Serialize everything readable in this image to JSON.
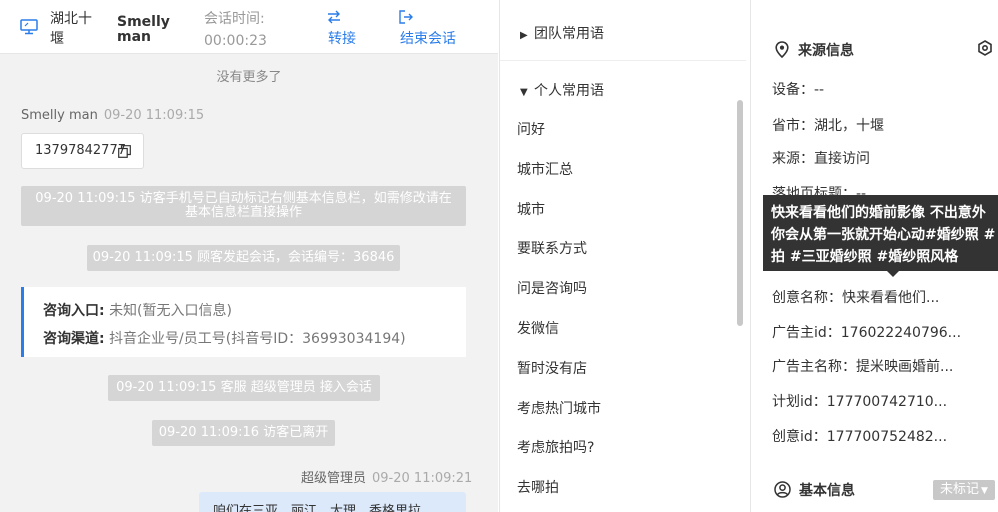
{
  "header": {
    "location": "湖北十堰",
    "visitor_name": "Smelly man",
    "session_time_label": "会话时间:",
    "session_time_value": "00:00:23",
    "transfer_label": "转接",
    "end_label": "结束会话",
    "accent_color": "#2b7de9"
  },
  "chat": {
    "no_more": "没有更多了",
    "visitor_msg": {
      "sender": "Smelly man",
      "time": "09-20 11:09:15",
      "text": "13797842777"
    },
    "system_msgs": [
      {
        "line1": "09-20 11:09:15 访客手机号已自动标记右侧基本信息栏，如需修改请在",
        "line2": "基本信息栏直接操作"
      },
      {
        "text": "09-20 11:09:15 顾客发起会话，会话编号：36846"
      },
      {
        "text": "09-20 11:09:15 客服 超级管理员 接入会话"
      },
      {
        "text": "09-20 11:09:16 访客已离开"
      }
    ],
    "info_card": {
      "entry_label": "咨询入口:",
      "entry_value": "未知(暂无入口信息)",
      "channel_label": "咨询渠道:",
      "channel_value": "抖音企业号/员工号(抖音号ID：36993034194)"
    },
    "agent_msg": {
      "sender": "超级管理员",
      "time": "09-20 11:09:21",
      "text": "咱们在三亚，丽江，大理，香格里拉"
    }
  },
  "phrases": {
    "team_label": "团队常用语",
    "personal_label": "个人常用语",
    "items": [
      "问好",
      "城市汇总",
      "城市",
      "要联系方式",
      "问是咨询吗",
      "发微信",
      "暂时没有店",
      "考虑热门城市",
      "考虑旅拍吗?",
      "去哪拍"
    ]
  },
  "info": {
    "source_title": "来源信息",
    "fields": [
      "设备：--",
      "省市：湖北，十堰",
      "来源：直接访问",
      "落地页标题：--",
      "创意名称：快来看看他们...",
      "广告主id：176022240796...",
      "广告主名称：提米映画婚前...",
      "计划id：177700742710...",
      "创意id：177700752482..."
    ],
    "tooltip_lines": [
      "快来看看他们的婚前影像 不出意外",
      "你会从第一张就开始心动#婚纱照 #",
      "拍 #三亚婚纱照 #婚纱照风格"
    ],
    "basic_title": "基本信息",
    "tag_label": "未标记"
  }
}
